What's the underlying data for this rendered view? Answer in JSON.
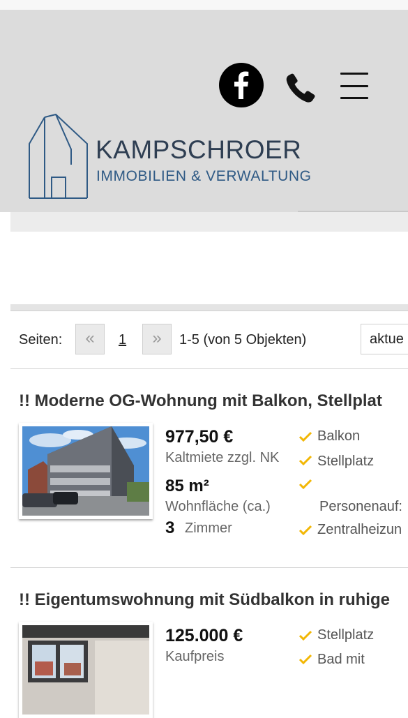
{
  "header": {
    "logo_name": "KAMPSCHROER",
    "logo_sub": "IMMOBILIEN & VERWALTUNG",
    "icons": [
      "facebook-icon",
      "phone-icon",
      "hamburger-menu-icon"
    ]
  },
  "pagination": {
    "label": "Seiten:",
    "prev": "«",
    "page": "1",
    "next": "»",
    "range": "1-5 (von 5 Objekten)",
    "sort_value": "aktue"
  },
  "listings": [
    {
      "title": "!! Moderne OG-Wohnung mit Balkon, Stellplat",
      "price": "977,50 €",
      "price_label": "Kaltmiete zzgl. NK",
      "area": "85 m²",
      "area_label": "Wohnfläche (ca.)",
      "rooms": "3",
      "rooms_label": "Zimmer",
      "features": [
        "Balkon",
        "Stellplatz",
        "",
        "Personenauf:",
        "Zentralheizun"
      ]
    },
    {
      "title": "!! Eigentumswohnung mit Südbalkon in ruhige",
      "price": "125.000 €",
      "price_label": "Kaufpreis",
      "features": [
        "Stellplatz",
        "Bad mit"
      ]
    }
  ],
  "colors": {
    "header_bg": "#dcdcdc",
    "logo_dark": "#2e3e52",
    "logo_blue": "#2f5a85",
    "check": "#f2b705"
  }
}
